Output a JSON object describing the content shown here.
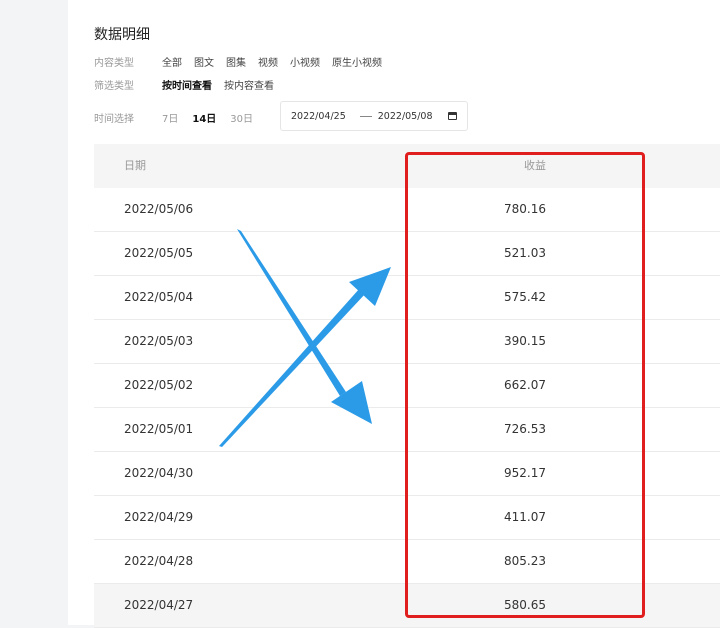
{
  "page": {
    "title": "数据明细"
  },
  "filters": {
    "content_type_label": "内容类型",
    "content_types": [
      "全部",
      "图文",
      "图集",
      "视频",
      "小视频",
      "原生小视频"
    ],
    "filter_type_label": "筛选类型",
    "filter_types": [
      "按时间查看",
      "按内容查看"
    ],
    "time_label": "时间选择",
    "ranges": [
      "7日",
      "14日",
      "30日"
    ],
    "active_range": "14日",
    "date_start": "2022/04/25",
    "date_end": "2022/05/08"
  },
  "table": {
    "headers": {
      "date": "日期",
      "income": "收益"
    },
    "rows": [
      {
        "date": "2022/05/06",
        "income": "780.16"
      },
      {
        "date": "2022/05/05",
        "income": "521.03"
      },
      {
        "date": "2022/05/04",
        "income": "575.42"
      },
      {
        "date": "2022/05/03",
        "income": "390.15"
      },
      {
        "date": "2022/05/02",
        "income": "662.07"
      },
      {
        "date": "2022/05/01",
        "income": "726.53"
      },
      {
        "date": "2022/04/30",
        "income": "952.17"
      },
      {
        "date": "2022/04/29",
        "income": "411.07"
      },
      {
        "date": "2022/04/28",
        "income": "805.23"
      },
      {
        "date": "2022/04/27",
        "income": "580.65"
      }
    ]
  },
  "annotations": {
    "highlight_color": "#e01e1e",
    "cross_color": "#2b9be8"
  }
}
